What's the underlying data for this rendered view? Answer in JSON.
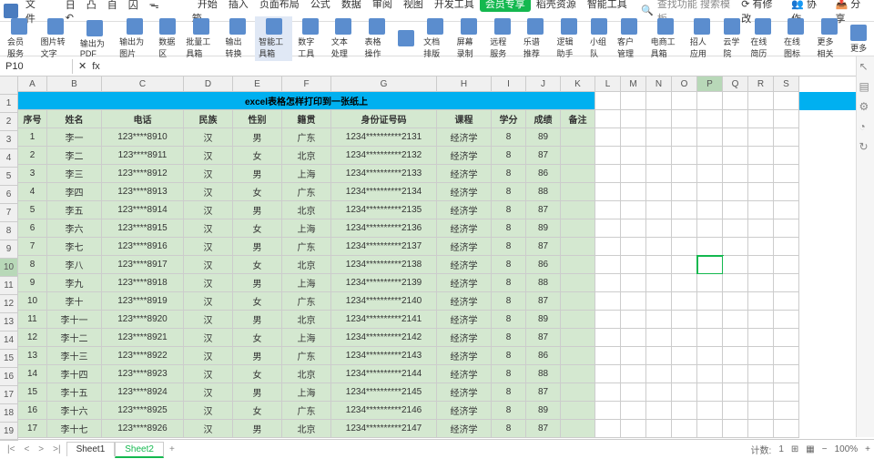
{
  "top": {
    "file": "文件",
    "items": [
      "日",
      "凸",
      "自",
      "囚",
      "ᯓ",
      "↶"
    ],
    "tabs": [
      "开始",
      "插入",
      "页面布局",
      "公式",
      "数据",
      "审阅",
      "视图",
      "开发工具",
      "会员专享",
      "稻壳资源",
      "智能工具箱"
    ],
    "search_ph": "查找功能 搜索模板",
    "right": [
      "有修改",
      "协作",
      "分享"
    ]
  },
  "ribbon": [
    "会员服务",
    "图片转文字",
    "输出为PDF",
    "输出为图片",
    "数据区",
    "批量工具箱",
    "输出转换",
    "智能工具箱",
    "数字工具",
    "文本处理",
    "表格操作",
    "",
    "文档排版",
    "屏幕录制",
    "远程服务",
    "乐谱推荐",
    "逻辑助手",
    "小组队",
    "客户管理",
    "电商工具箱",
    "招人应用",
    "云学院",
    "在线简历",
    "在线图标",
    "更多相关",
    "更多"
  ],
  "cellref": "P10",
  "fx": "fx",
  "cols": [
    "A",
    "B",
    "C",
    "D",
    "E",
    "F",
    "G",
    "H",
    "I",
    "J",
    "K",
    "L",
    "M",
    "N",
    "O",
    "P",
    "Q",
    "R",
    "S"
  ],
  "widths": [
    32,
    60,
    90,
    54,
    54,
    54,
    116,
    60,
    38,
    38,
    38,
    28,
    28,
    28,
    28,
    28,
    28,
    28,
    28
  ],
  "title": "excel表格怎样打印到一张纸上",
  "headers": [
    "序号",
    "姓名",
    "电话",
    "民族",
    "性别",
    "籍贯",
    "身份证号码",
    "课程",
    "学分",
    "成绩",
    "备注"
  ],
  "rows": [
    [
      "1",
      "李一",
      "123****8910",
      "汉",
      "男",
      "广东",
      "1234**********2131",
      "经济学",
      "8",
      "89",
      ""
    ],
    [
      "2",
      "李二",
      "123****8911",
      "汉",
      "女",
      "北京",
      "1234**********2132",
      "经济学",
      "8",
      "87",
      ""
    ],
    [
      "3",
      "李三",
      "123****8912",
      "汉",
      "男",
      "上海",
      "1234**********2133",
      "经济学",
      "8",
      "86",
      ""
    ],
    [
      "4",
      "李四",
      "123****8913",
      "汉",
      "女",
      "广东",
      "1234**********2134",
      "经济学",
      "8",
      "88",
      ""
    ],
    [
      "5",
      "李五",
      "123****8914",
      "汉",
      "男",
      "北京",
      "1234**********2135",
      "经济学",
      "8",
      "87",
      ""
    ],
    [
      "6",
      "李六",
      "123****8915",
      "汉",
      "女",
      "上海",
      "1234**********2136",
      "经济学",
      "8",
      "89",
      ""
    ],
    [
      "7",
      "李七",
      "123****8916",
      "汉",
      "男",
      "广东",
      "1234**********2137",
      "经济学",
      "8",
      "87",
      ""
    ],
    [
      "8",
      "李八",
      "123****8917",
      "汉",
      "女",
      "北京",
      "1234**********2138",
      "经济学",
      "8",
      "86",
      ""
    ],
    [
      "9",
      "李九",
      "123****8918",
      "汉",
      "男",
      "上海",
      "1234**********2139",
      "经济学",
      "8",
      "88",
      ""
    ],
    [
      "10",
      "李十",
      "123****8919",
      "汉",
      "女",
      "广东",
      "1234**********2140",
      "经济学",
      "8",
      "87",
      ""
    ],
    [
      "11",
      "李十一",
      "123****8920",
      "汉",
      "男",
      "北京",
      "1234**********2141",
      "经济学",
      "8",
      "89",
      ""
    ],
    [
      "12",
      "李十二",
      "123****8921",
      "汉",
      "女",
      "上海",
      "1234**********2142",
      "经济学",
      "8",
      "87",
      ""
    ],
    [
      "13",
      "李十三",
      "123****8922",
      "汉",
      "男",
      "广东",
      "1234**********2143",
      "经济学",
      "8",
      "86",
      ""
    ],
    [
      "14",
      "李十四",
      "123****8923",
      "汉",
      "女",
      "北京",
      "1234**********2144",
      "经济学",
      "8",
      "88",
      ""
    ],
    [
      "15",
      "李十五",
      "123****8924",
      "汉",
      "男",
      "上海",
      "1234**********2145",
      "经济学",
      "8",
      "87",
      ""
    ],
    [
      "16",
      "李十六",
      "123****8925",
      "汉",
      "女",
      "广东",
      "1234**********2146",
      "经济学",
      "8",
      "89",
      ""
    ],
    [
      "17",
      "李十七",
      "123****8926",
      "汉",
      "男",
      "北京",
      "1234**********2147",
      "经济学",
      "8",
      "87",
      ""
    ]
  ],
  "sheets": [
    "Sheet1",
    "Sheet2"
  ],
  "active_sheet": 1,
  "zoom": "100%",
  "count": "1",
  "sel": {
    "row": 10,
    "col": "P"
  }
}
